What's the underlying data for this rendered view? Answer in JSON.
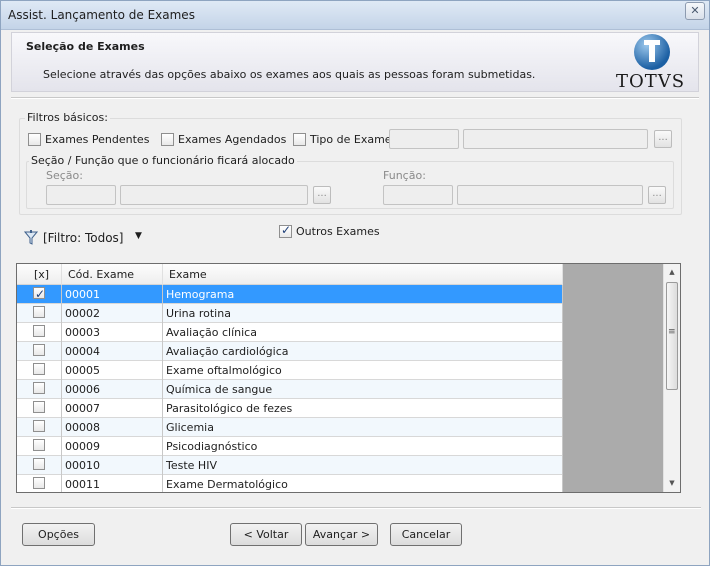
{
  "window": {
    "title": "Assist. Lançamento de Exames",
    "close_glyph": "✕"
  },
  "header": {
    "title": "Seleção de Exames",
    "description": "Selecione através das opções abaixo os exames aos quais as pessoas foram submetidas.",
    "logo_text": "TOTVS"
  },
  "filters": {
    "legend": "Filtros básicos:",
    "pendentes": {
      "label": "Exames Pendentes",
      "checked": false
    },
    "agendados": {
      "label": "Exames Agendados",
      "checked": false
    },
    "tipo": {
      "label": "Tipo de Exame",
      "checked": false
    },
    "secao_funcao": {
      "legend": "Seção / Função que o funcionário ficará alocado",
      "secao_label": "Seção:",
      "funcao_label": "Função:"
    },
    "lookup_button": "..."
  },
  "filter_menu": {
    "label": "[Filtro: Todos]",
    "icon": "filter-icon"
  },
  "outros": {
    "label": "Outros Exames",
    "checked": true
  },
  "grid": {
    "columns": [
      "[x]",
      "Cód. Exame",
      "Exame"
    ],
    "rows": [
      {
        "checked": true,
        "code": "00001",
        "name": "Hemograma"
      },
      {
        "checked": false,
        "code": "00002",
        "name": "Urina rotina"
      },
      {
        "checked": false,
        "code": "00003",
        "name": "Avaliação clínica"
      },
      {
        "checked": false,
        "code": "00004",
        "name": "Avaliação cardiológica"
      },
      {
        "checked": false,
        "code": "00005",
        "name": "Exame oftalmológico"
      },
      {
        "checked": false,
        "code": "00006",
        "name": "Química de sangue"
      },
      {
        "checked": false,
        "code": "00007",
        "name": "Parasitológico de fezes"
      },
      {
        "checked": false,
        "code": "00008",
        "name": "Glicemia"
      },
      {
        "checked": false,
        "code": "00009",
        "name": "Psicodiagnóstico"
      },
      {
        "checked": false,
        "code": "00010",
        "name": "Teste HIV"
      },
      {
        "checked": false,
        "code": "00011",
        "name": "Exame Dermatológico"
      }
    ],
    "selected_row_color": "#3399ff"
  },
  "buttons": {
    "opcoes": "Opções",
    "voltar": "< Voltar",
    "avancar": "Avançar >",
    "cancelar": "Cancelar"
  }
}
